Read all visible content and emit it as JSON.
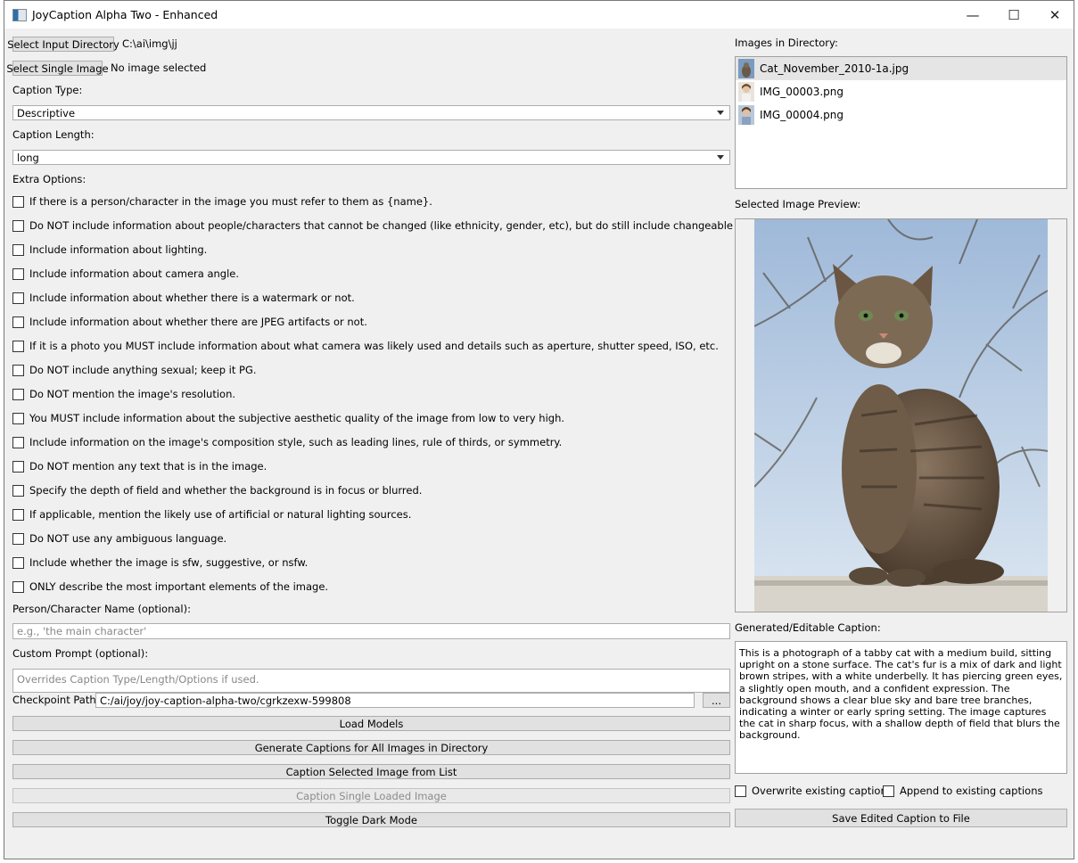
{
  "window": {
    "title": "JoyCaption Alpha Two - Enhanced",
    "minimize": "—",
    "maximize": "☐",
    "close": "✕"
  },
  "left": {
    "select_input_dir_btn": "Select Input Directory",
    "input_dir_path": "C:\\ai\\img\\jj",
    "select_single_btn": "Select Single Image",
    "single_status": "No image selected",
    "caption_type_label": "Caption Type:",
    "caption_type_value": "Descriptive",
    "caption_length_label": "Caption Length:",
    "caption_length_value": "long",
    "extra_options_label": "Extra Options:",
    "extra_options": [
      "If there is a person/character in the image you must refer to them as {name}.",
      "Do NOT include information about people/characters that cannot be changed (like ethnicity, gender, etc), but do still include changeable attributes (like hair style).",
      "Include information about lighting.",
      "Include information about camera angle.",
      "Include information about whether there is a watermark or not.",
      "Include information about whether there are JPEG artifacts or not.",
      "If it is a photo you MUST include information about what camera was likely used and details such as aperture, shutter speed, ISO, etc.",
      "Do NOT include anything sexual; keep it PG.",
      "Do NOT mention the image's resolution.",
      "You MUST include information about the subjective aesthetic quality of the image from low to very high.",
      "Include information on the image's composition style, such as leading lines, rule of thirds, or symmetry.",
      "Do NOT mention any text that is in the image.",
      "Specify the depth of field and whether the background is in focus or blurred.",
      "If applicable, mention the likely use of artificial or natural lighting sources.",
      "Do NOT use any ambiguous language.",
      "Include whether the image is sfw, suggestive, or nsfw.",
      "ONLY describe the most important elements of the image."
    ],
    "person_name_label": "Person/Character Name (optional):",
    "person_name_placeholder": "e.g., 'the main character'",
    "custom_prompt_label": "Custom Prompt (optional):",
    "custom_prompt_placeholder": "Overrides Caption Type/Length/Options if used.",
    "checkpoint_label": "Checkpoint Path:",
    "checkpoint_value": "C:/ai/joy/joy-caption-alpha-two/cgrkzexw-599808",
    "browse_btn": "...",
    "load_models_btn": "Load Models",
    "generate_all_btn": "Generate Captions for All Images in Directory",
    "caption_selected_btn": "Caption Selected Image from List",
    "caption_single_btn": "Caption Single Loaded Image",
    "toggle_dark_btn": "Toggle Dark Mode"
  },
  "right": {
    "images_label": "Images in Directory:",
    "files": [
      "Cat_November_2010-1a.jpg",
      "IMG_00003.png",
      "IMG_00004.png"
    ],
    "preview_label": "Selected Image Preview:",
    "caption_label": "Generated/Editable Caption:",
    "caption_text": "This is a photograph of a tabby cat with a medium build, sitting upright on a stone surface. The cat's fur is a mix of dark and light brown stripes, with a white underbelly. It has piercing green eyes, a slightly open mouth, and a confident expression. The background shows a clear blue sky and bare tree branches, indicating a winter or early spring setting. The image captures the cat in sharp focus, with a shallow depth of field that blurs the background.",
    "overwrite_label": "Overwrite existing captions",
    "append_label": "Append to existing captions",
    "save_btn": "Save Edited Caption to File"
  },
  "colors": {
    "button_bg": "#e1e1e1",
    "window_bg": "#f0f0f0",
    "selected_row": "#e5e5e5"
  }
}
